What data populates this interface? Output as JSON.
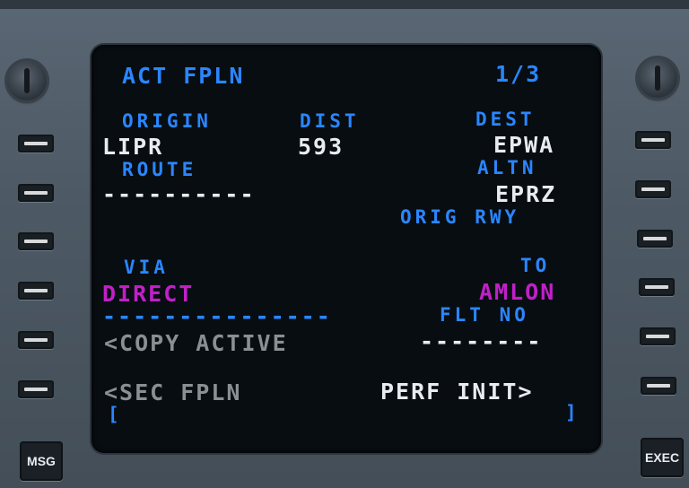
{
  "cdu": {
    "title": "ACT FPLN",
    "page": "1/3",
    "origin_label": "ORIGIN",
    "dist_label": "DIST",
    "dest_label": "DEST",
    "origin": "LIPR",
    "dist": "593",
    "dest": "EPWA",
    "route_label": "ROUTE",
    "altn_label": "ALTN",
    "route": "----------",
    "altn": "EPRZ",
    "orig_rwy_label": "ORIG RWY",
    "via_label": "VIA",
    "to_label": "TO",
    "via": "DIRECT",
    "to": "AMLON",
    "dashes_line": "---------------",
    "flt_no_label": "FLT NO",
    "copy_active": "<COPY ACTIVE",
    "flt_no": "--------",
    "sec_fpln": "<SEC FPLN",
    "perf_init": "PERF INIT>",
    "scratch_open": "[",
    "scratch_close": "]"
  },
  "buttons": {
    "msg": "MSG",
    "exec": "EXEC"
  },
  "colors": {
    "label_blue": "#2a86ff",
    "value_white": "#e8ecef",
    "inactive_grey": "#8a8f94",
    "active_magenta": "#c020c8"
  }
}
